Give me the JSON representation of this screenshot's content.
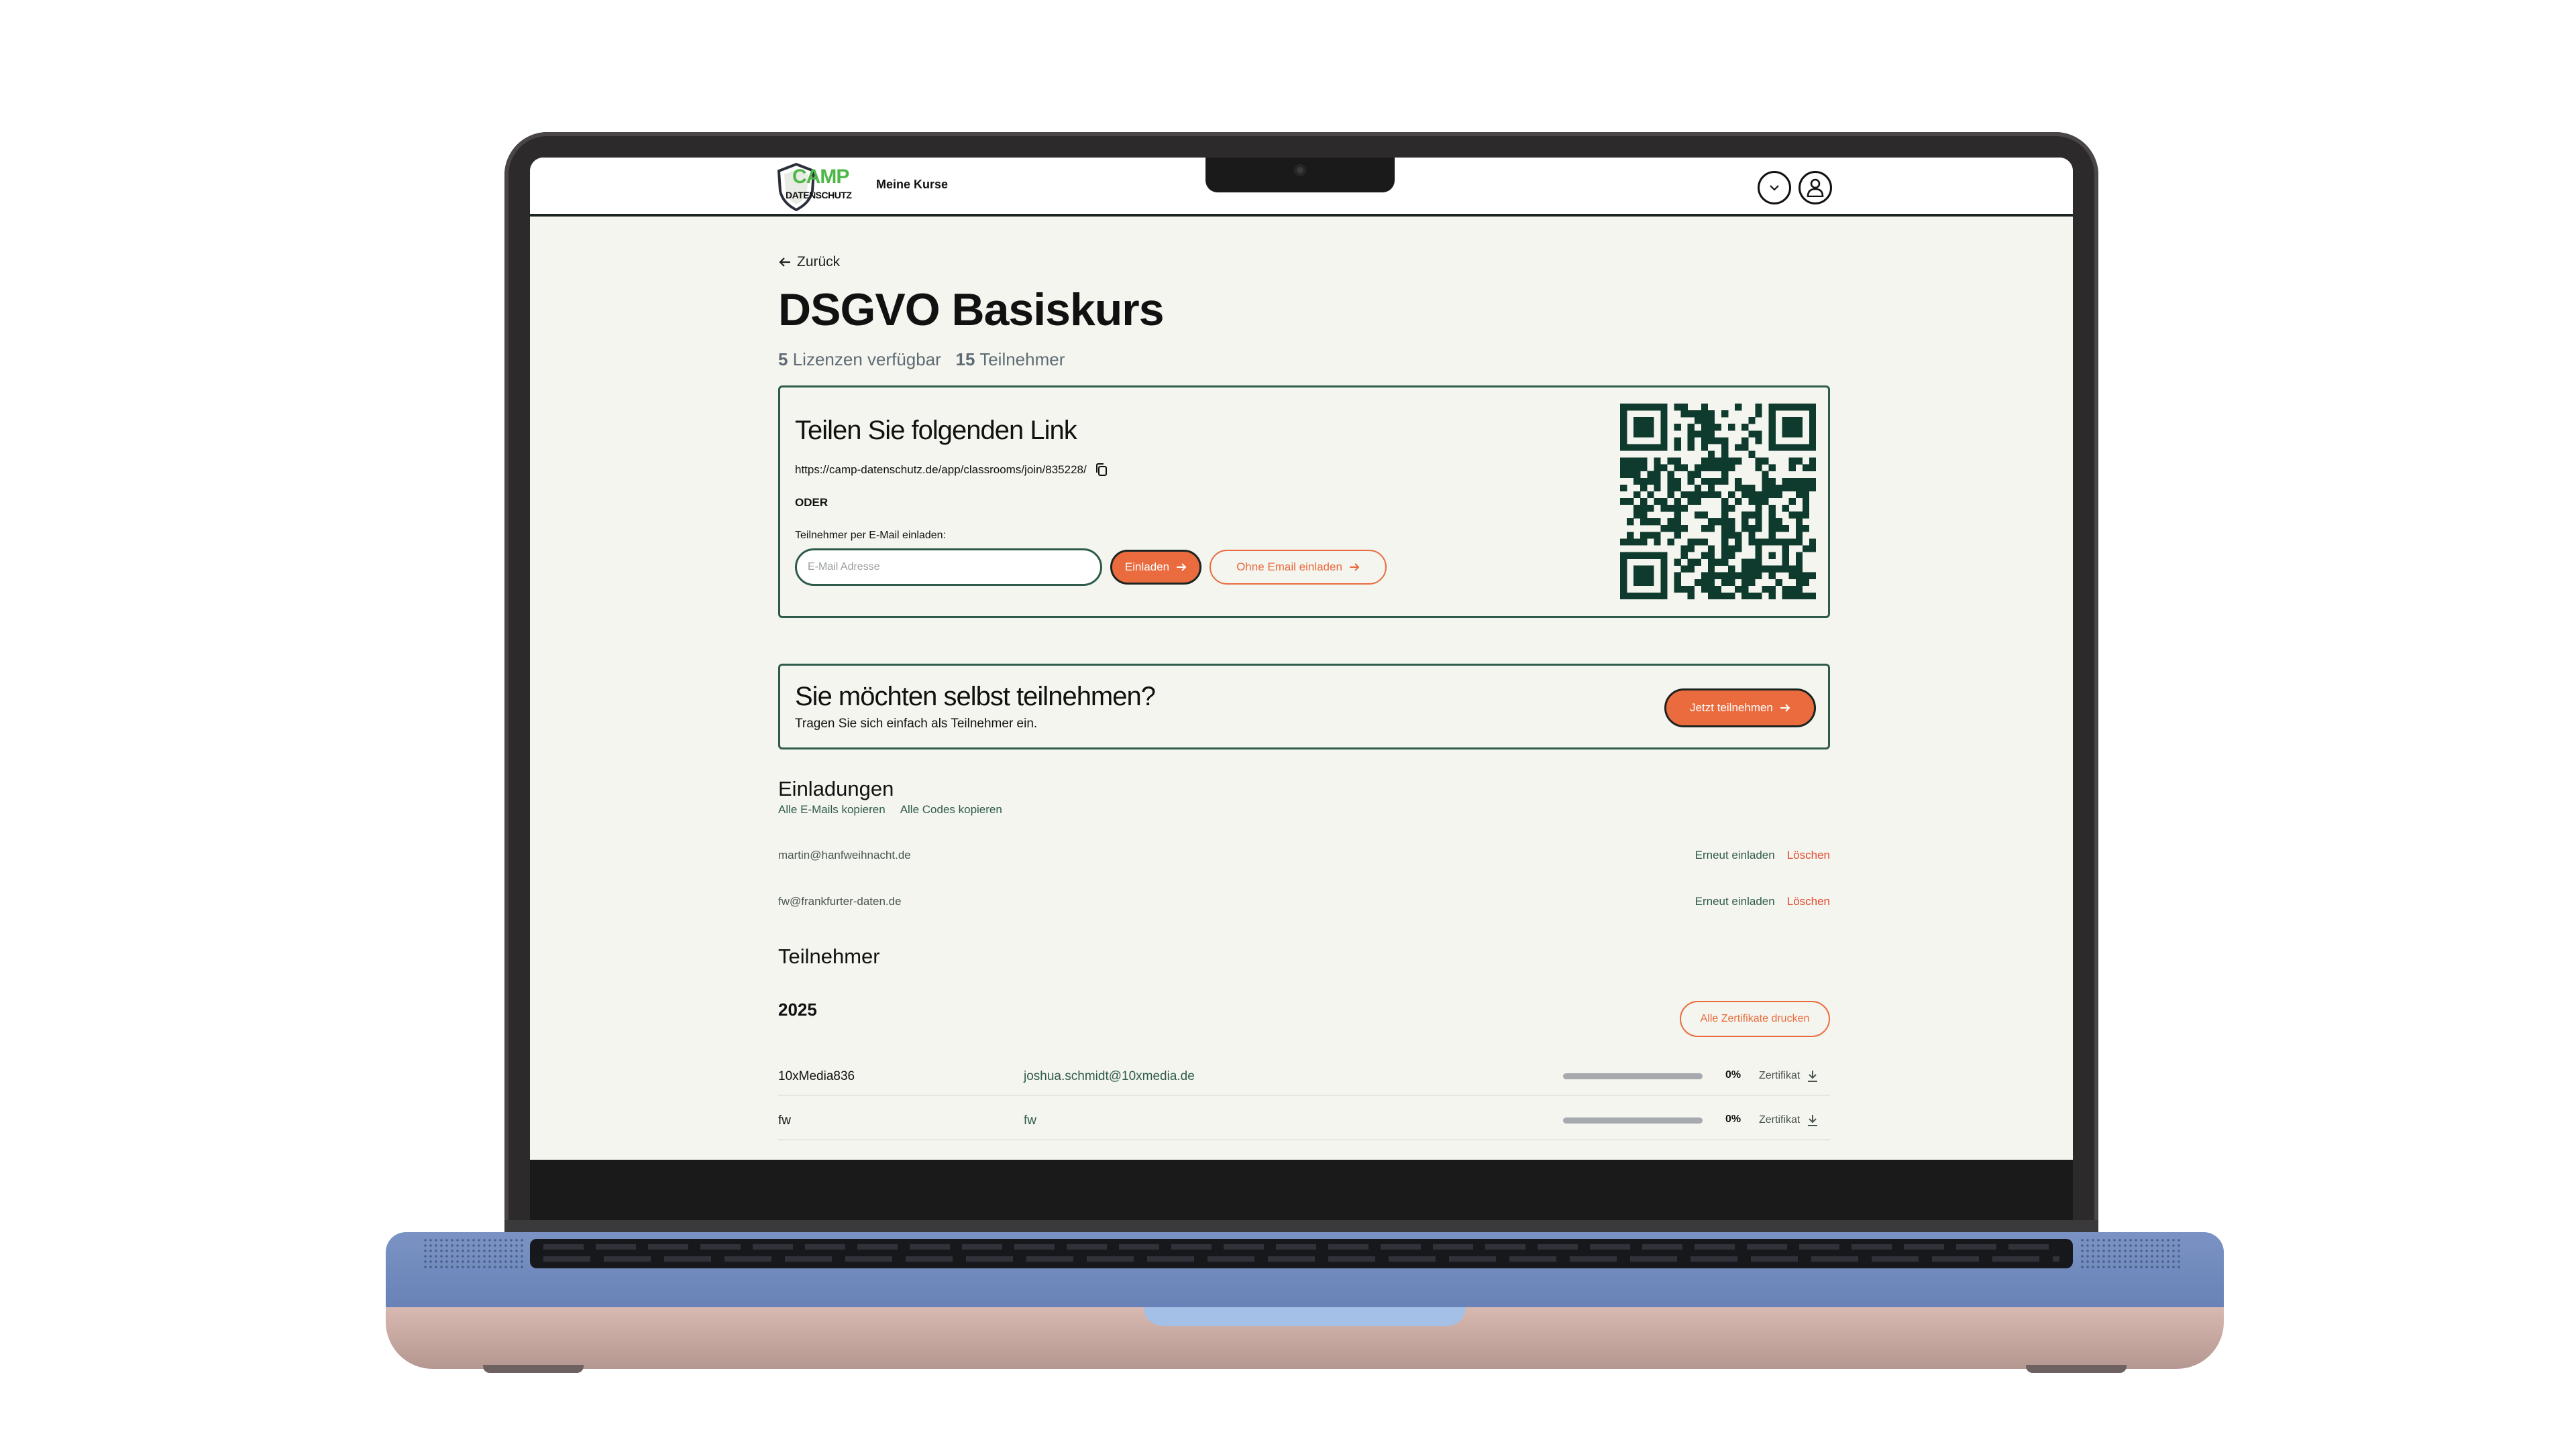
{
  "header": {
    "logo_top": "CAMP",
    "logo_bottom": "DATENSCHUTZ",
    "nav_item": "Meine Kurse",
    "dropdown_icon": "chevron-down-icon",
    "user_icon": "user-icon"
  },
  "page": {
    "back_label": "Zurück",
    "title": "DSGVO Basiskurs",
    "licenses_count": "5",
    "licenses_label": "Lizenzen verfügbar",
    "participants_count": "15",
    "participants_label": "Teilnehmer"
  },
  "share": {
    "heading": "Teilen Sie folgenden Link",
    "link": "https://camp-datenschutz.de/app/classrooms/join/835228/",
    "or_label": "ODER",
    "invite_label": "Teilnehmer per E-Mail einladen:",
    "email_placeholder": "E-Mail Adresse",
    "invite_button": "Einladen",
    "no_email_button": "Ohne Email einladen",
    "qr_icon": "qr-code"
  },
  "join": {
    "heading": "Sie möchten selbst teilnehmen?",
    "subtext": "Tragen Sie sich einfach als Teilnehmer ein.",
    "button": "Jetzt teilnehmen"
  },
  "invitations": {
    "heading": "Einladungen",
    "copy_emails": "Alle E-Mails kopieren",
    "copy_codes": "Alle Codes kopieren",
    "rows": [
      {
        "email": "martin@hanfweihnacht.de",
        "reinvite": "Erneut einladen",
        "delete": "Löschen"
      },
      {
        "email": "fw@frankfurter-daten.de",
        "reinvite": "Erneut einladen",
        "delete": "Löschen"
      }
    ]
  },
  "participants": {
    "heading": "Teilnehmer",
    "year": "2025",
    "print_all": "Alle Zertifikate drucken",
    "rows": [
      {
        "name": "10xMedia836",
        "email": "joshua.schmidt@10xmedia.de",
        "progress": 0,
        "progress_label": "0%",
        "cert": "Zertifikat"
      },
      {
        "name": "fw",
        "email": "fw",
        "progress": 0,
        "progress_label": "0%",
        "cert": "Zertifikat"
      }
    ]
  },
  "colors": {
    "accent": "#ea6b3e",
    "brand_green": "#2f5b4b",
    "logo_green": "#4db848",
    "danger": "#e34a30",
    "page_bg": "#f4f5ee"
  }
}
